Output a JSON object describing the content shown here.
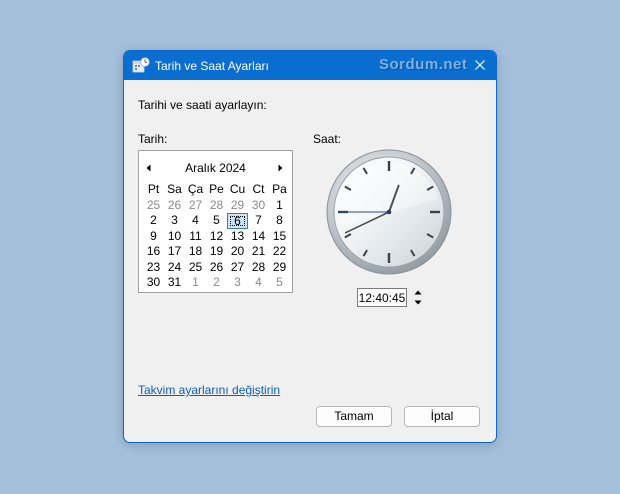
{
  "window": {
    "title": "Tarih ve Saat Ayarları",
    "watermark": "Sordum.net"
  },
  "prompt": "Tarihi ve saati ayarlayın:",
  "date_label": "Tarih:",
  "time_label": "Saat:",
  "calendar": {
    "month_year": "Aralık 2024",
    "weekdays": [
      "Pt",
      "Sa",
      "Ça",
      "Pe",
      "Cu",
      "Ct",
      "Pa"
    ],
    "weeks": [
      [
        {
          "d": "25",
          "o": true
        },
        {
          "d": "26",
          "o": true
        },
        {
          "d": "27",
          "o": true
        },
        {
          "d": "28",
          "o": true
        },
        {
          "d": "29",
          "o": true
        },
        {
          "d": "30",
          "o": true
        },
        {
          "d": "1"
        }
      ],
      [
        {
          "d": "2"
        },
        {
          "d": "3"
        },
        {
          "d": "4"
        },
        {
          "d": "5"
        },
        {
          "d": "6",
          "sel": true
        },
        {
          "d": "7"
        },
        {
          "d": "8"
        }
      ],
      [
        {
          "d": "9"
        },
        {
          "d": "10"
        },
        {
          "d": "11"
        },
        {
          "d": "12"
        },
        {
          "d": "13"
        },
        {
          "d": "14"
        },
        {
          "d": "15"
        }
      ],
      [
        {
          "d": "16"
        },
        {
          "d": "17"
        },
        {
          "d": "18"
        },
        {
          "d": "19"
        },
        {
          "d": "20"
        },
        {
          "d": "21"
        },
        {
          "d": "22"
        }
      ],
      [
        {
          "d": "23"
        },
        {
          "d": "24"
        },
        {
          "d": "25"
        },
        {
          "d": "26"
        },
        {
          "d": "27"
        },
        {
          "d": "28"
        },
        {
          "d": "29"
        }
      ],
      [
        {
          "d": "30"
        },
        {
          "d": "31"
        },
        {
          "d": "1",
          "o": true
        },
        {
          "d": "2",
          "o": true
        },
        {
          "d": "3",
          "o": true
        },
        {
          "d": "4",
          "o": true
        },
        {
          "d": "5",
          "o": true
        }
      ]
    ]
  },
  "time": {
    "value": "12:40:45"
  },
  "link": "Takvim ayarlarını değiştirin",
  "buttons": {
    "ok": "Tamam",
    "cancel": "İptal"
  },
  "colors": {
    "titlebar": "#0a6ed1",
    "desktop": "#a3bfd9",
    "link": "#0a5ec0"
  }
}
